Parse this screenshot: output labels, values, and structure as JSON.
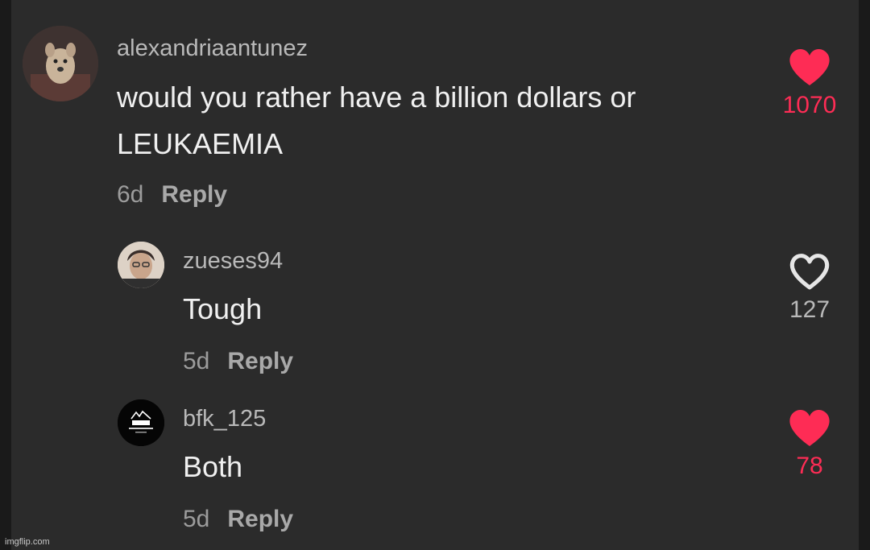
{
  "comments": [
    {
      "username": "alexandriaantunez",
      "text_line1": "would you rather have a billion dollars or",
      "text_line2": "LEUKAEMIA",
      "age": "6d",
      "reply_label": "Reply",
      "like_count": "1070",
      "liked": true
    },
    {
      "username": "zueses94",
      "text_line1": "Tough",
      "age": "5d",
      "reply_label": "Reply",
      "like_count": "127",
      "liked": false
    },
    {
      "username": "bfk_125",
      "text_line1": "Both",
      "age": "5d",
      "reply_label": "Reply",
      "like_count": "78",
      "liked": true
    }
  ],
  "watermark": "imgflip.com",
  "colors": {
    "background": "#2b2b2b",
    "like_active": "#fe2c55",
    "like_inactive": "#e6e6e6"
  },
  "icons": {
    "liked": "heart-filled-icon",
    "unliked": "heart-outline-icon"
  }
}
